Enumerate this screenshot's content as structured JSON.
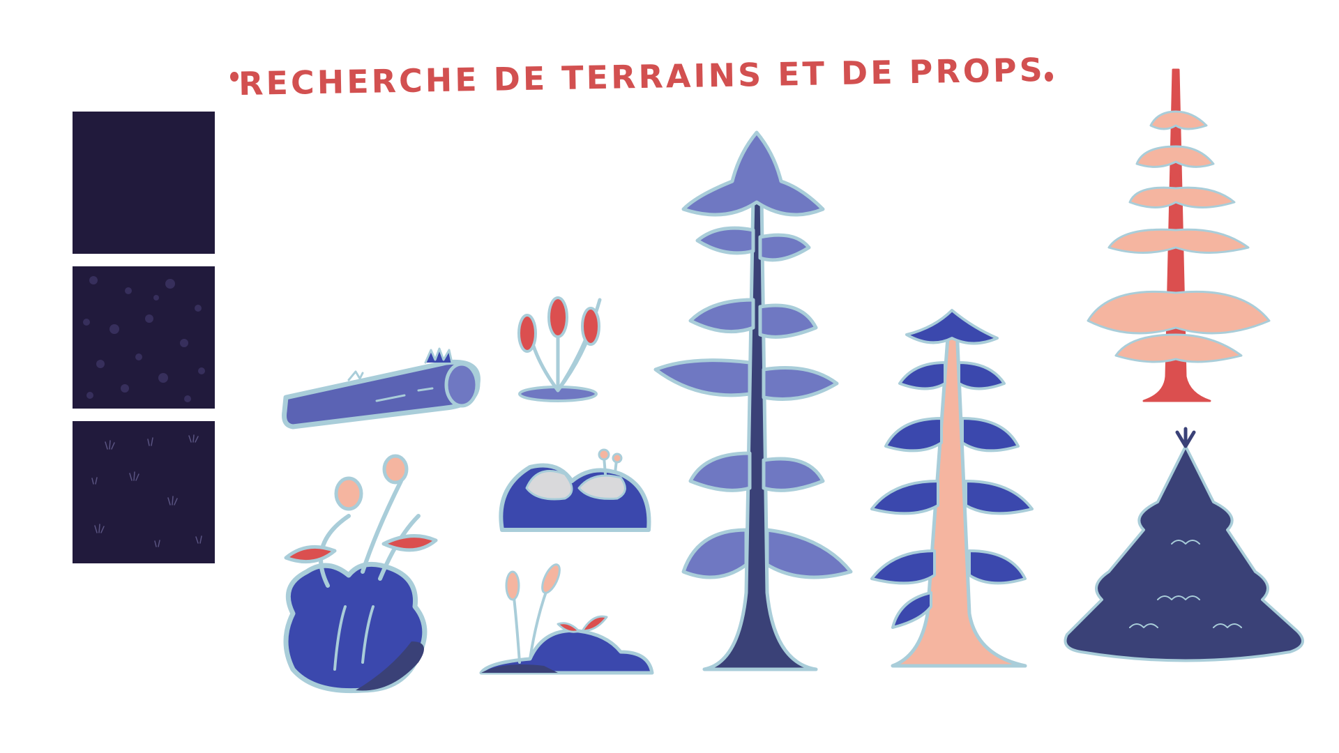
{
  "title": "RECHERCHE DE TERRAINS ET DE PROPS",
  "colors": {
    "accent": "#d25050",
    "ground_dark": "#211a3c",
    "outline_light": "#a9cdd9",
    "periwinkle": "#6f78c2",
    "royal_blue": "#3b48ad",
    "navy": "#3a4177",
    "peach": "#f5b5a0",
    "red": "#db4f4f",
    "rock_grey": "#d9d9db"
  },
  "swatches": [
    {
      "name": "plain-ground"
    },
    {
      "name": "dotted-ground"
    },
    {
      "name": "grass-tuft-ground"
    }
  ],
  "props": [
    "log-prop",
    "cattail-prop",
    "flower-bush-prop",
    "mushroom-rocks-prop",
    "sprout-rock-prop",
    "tall-blue-pine",
    "peach-trunk-pine",
    "sparse-red-pine",
    "dark-fir-tree"
  ]
}
